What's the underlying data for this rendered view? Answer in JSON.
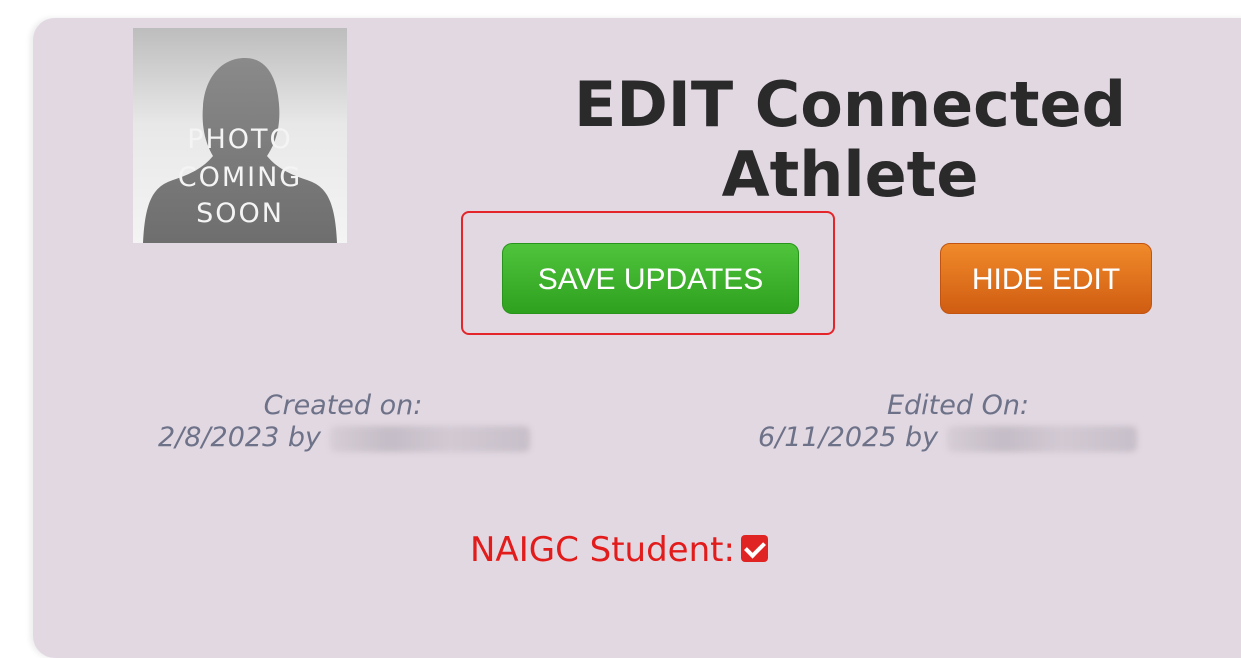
{
  "athlete_photo": {
    "placeholder_lines": [
      "PHOTO",
      "COMING",
      "SOON"
    ]
  },
  "page_title_line1": "EDIT Connected",
  "page_title_line2": "Athlete",
  "buttons": {
    "save_label": "SAVE UPDATES",
    "hide_label": "HIDE EDIT"
  },
  "created": {
    "label": "Created on:",
    "date_by": "2/8/2023 by"
  },
  "edited": {
    "label": "Edited On:",
    "date_by": "6/11/2025 by"
  },
  "naigc_student": {
    "label": "NAIGC Student:",
    "checked": true
  },
  "colors": {
    "save_button": "#2ea11f",
    "hide_button": "#d05d12",
    "highlight_outline": "#e4252a",
    "student_label": "#e21b1b",
    "panel_background": "#e2d8e2"
  }
}
